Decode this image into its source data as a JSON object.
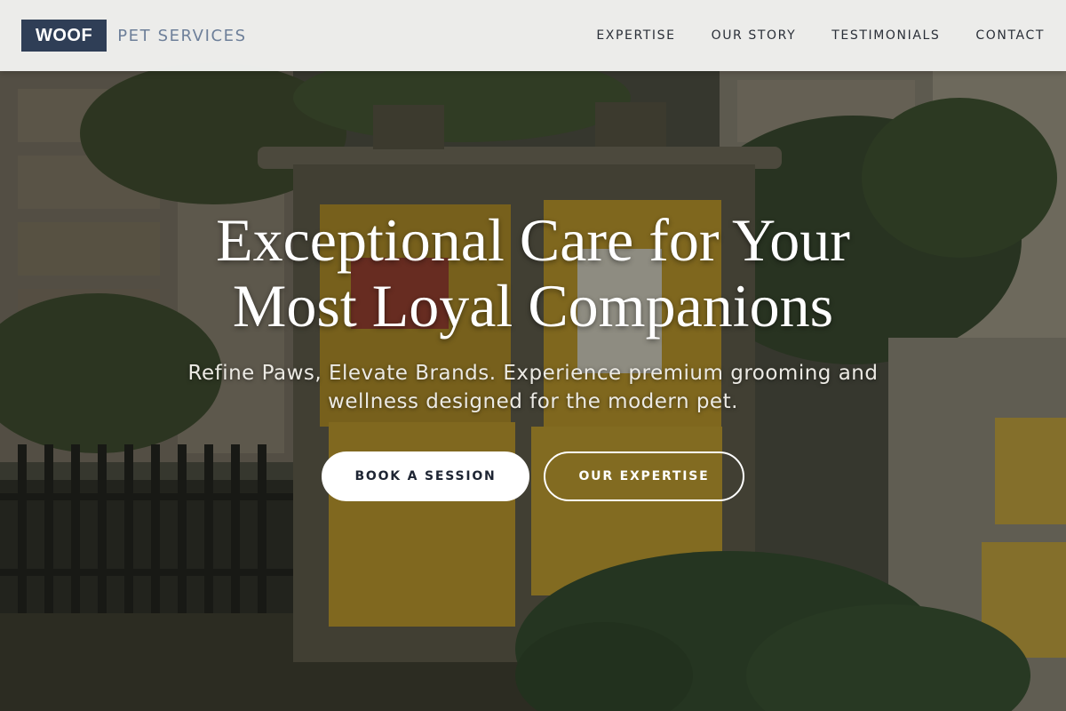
{
  "brand": {
    "logo_text": "WOOF",
    "name": "PET SERVICES"
  },
  "nav": {
    "items": [
      {
        "label": "EXPERTISE"
      },
      {
        "label": "OUR STORY"
      },
      {
        "label": "TESTIMONIALS"
      },
      {
        "label": "CONTACT"
      }
    ]
  },
  "hero": {
    "title_line1": "Exceptional Care for Your",
    "title_line2": "Most Loyal Companions",
    "subtitle_line1": "Refine Paws, Elevate Brands. Experience premium grooming and",
    "subtitle_line2": "wellness designed for the modern pet.",
    "primary_button": "BOOK A SESSION",
    "secondary_button": "OUR EXPERTISE"
  },
  "colors": {
    "brand_navy": "#2f3e56",
    "brand_text": "#6d7f99",
    "nav_bg": "#f4f4f3",
    "nav_text": "#2a2f38",
    "hero_text": "#ffffff",
    "poster_yellow": "#e2b52a"
  }
}
